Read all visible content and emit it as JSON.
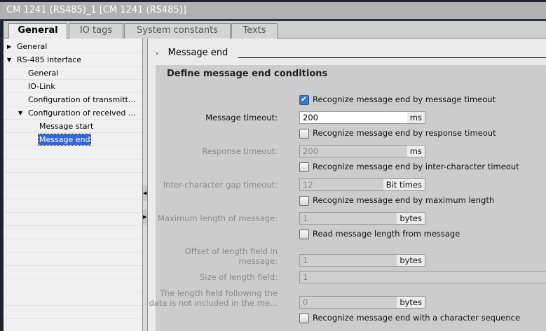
{
  "window": {
    "title": "CM 1241 (RS485)_1 [CM 1241 (RS485)]"
  },
  "tabs": [
    {
      "label": "General"
    },
    {
      "label": "IO tags"
    },
    {
      "label": "System constants"
    },
    {
      "label": "Texts"
    }
  ],
  "tree": [
    {
      "label": "General"
    },
    {
      "label": "RS-485 interface"
    },
    {
      "label": "General"
    },
    {
      "label": "IO-Link"
    },
    {
      "label": "Configuration of transmitt..."
    },
    {
      "label": "Configuration of received ..."
    },
    {
      "label": "Message start"
    },
    {
      "label": "Message end"
    }
  ],
  "section": {
    "title": "Message end",
    "panel_title": "Define message end conditions"
  },
  "form": {
    "cb_msg_timeout": {
      "label": "Recognize message end by message timeout",
      "checked": true
    },
    "msg_timeout": {
      "label": "Message timeout:",
      "value": "200",
      "unit": "ms"
    },
    "cb_resp_timeout": {
      "label": "Recognize message end by response timeout",
      "checked": false
    },
    "resp_timeout": {
      "label": "Response timeout:",
      "value": "200",
      "unit": "ms"
    },
    "cb_interchar": {
      "label": "Recognize message end by inter-character timeout",
      "checked": false
    },
    "interchar": {
      "label": "Inter-character gap timeout:",
      "value": "12",
      "unit": "Bit times"
    },
    "cb_maxlen": {
      "label": "Recognize message end by maximum length",
      "checked": false
    },
    "maxlen": {
      "label": "Maximum length of message:",
      "value": "1",
      "unit": "bytes"
    },
    "cb_readlen": {
      "label": "Read message length from message",
      "checked": false
    },
    "offset": {
      "label_1": "Offset of length field in",
      "label_2": "message:",
      "value": "1",
      "unit": "bytes"
    },
    "size": {
      "label": "Size of length field:",
      "value": "1"
    },
    "following": {
      "label_1": "The length field following the",
      "label_2": "data is not included in the me...",
      "value": "0",
      "unit": "bytes"
    },
    "cb_charseq": {
      "label": "Recognize message end with a character sequence",
      "checked": false
    }
  }
}
